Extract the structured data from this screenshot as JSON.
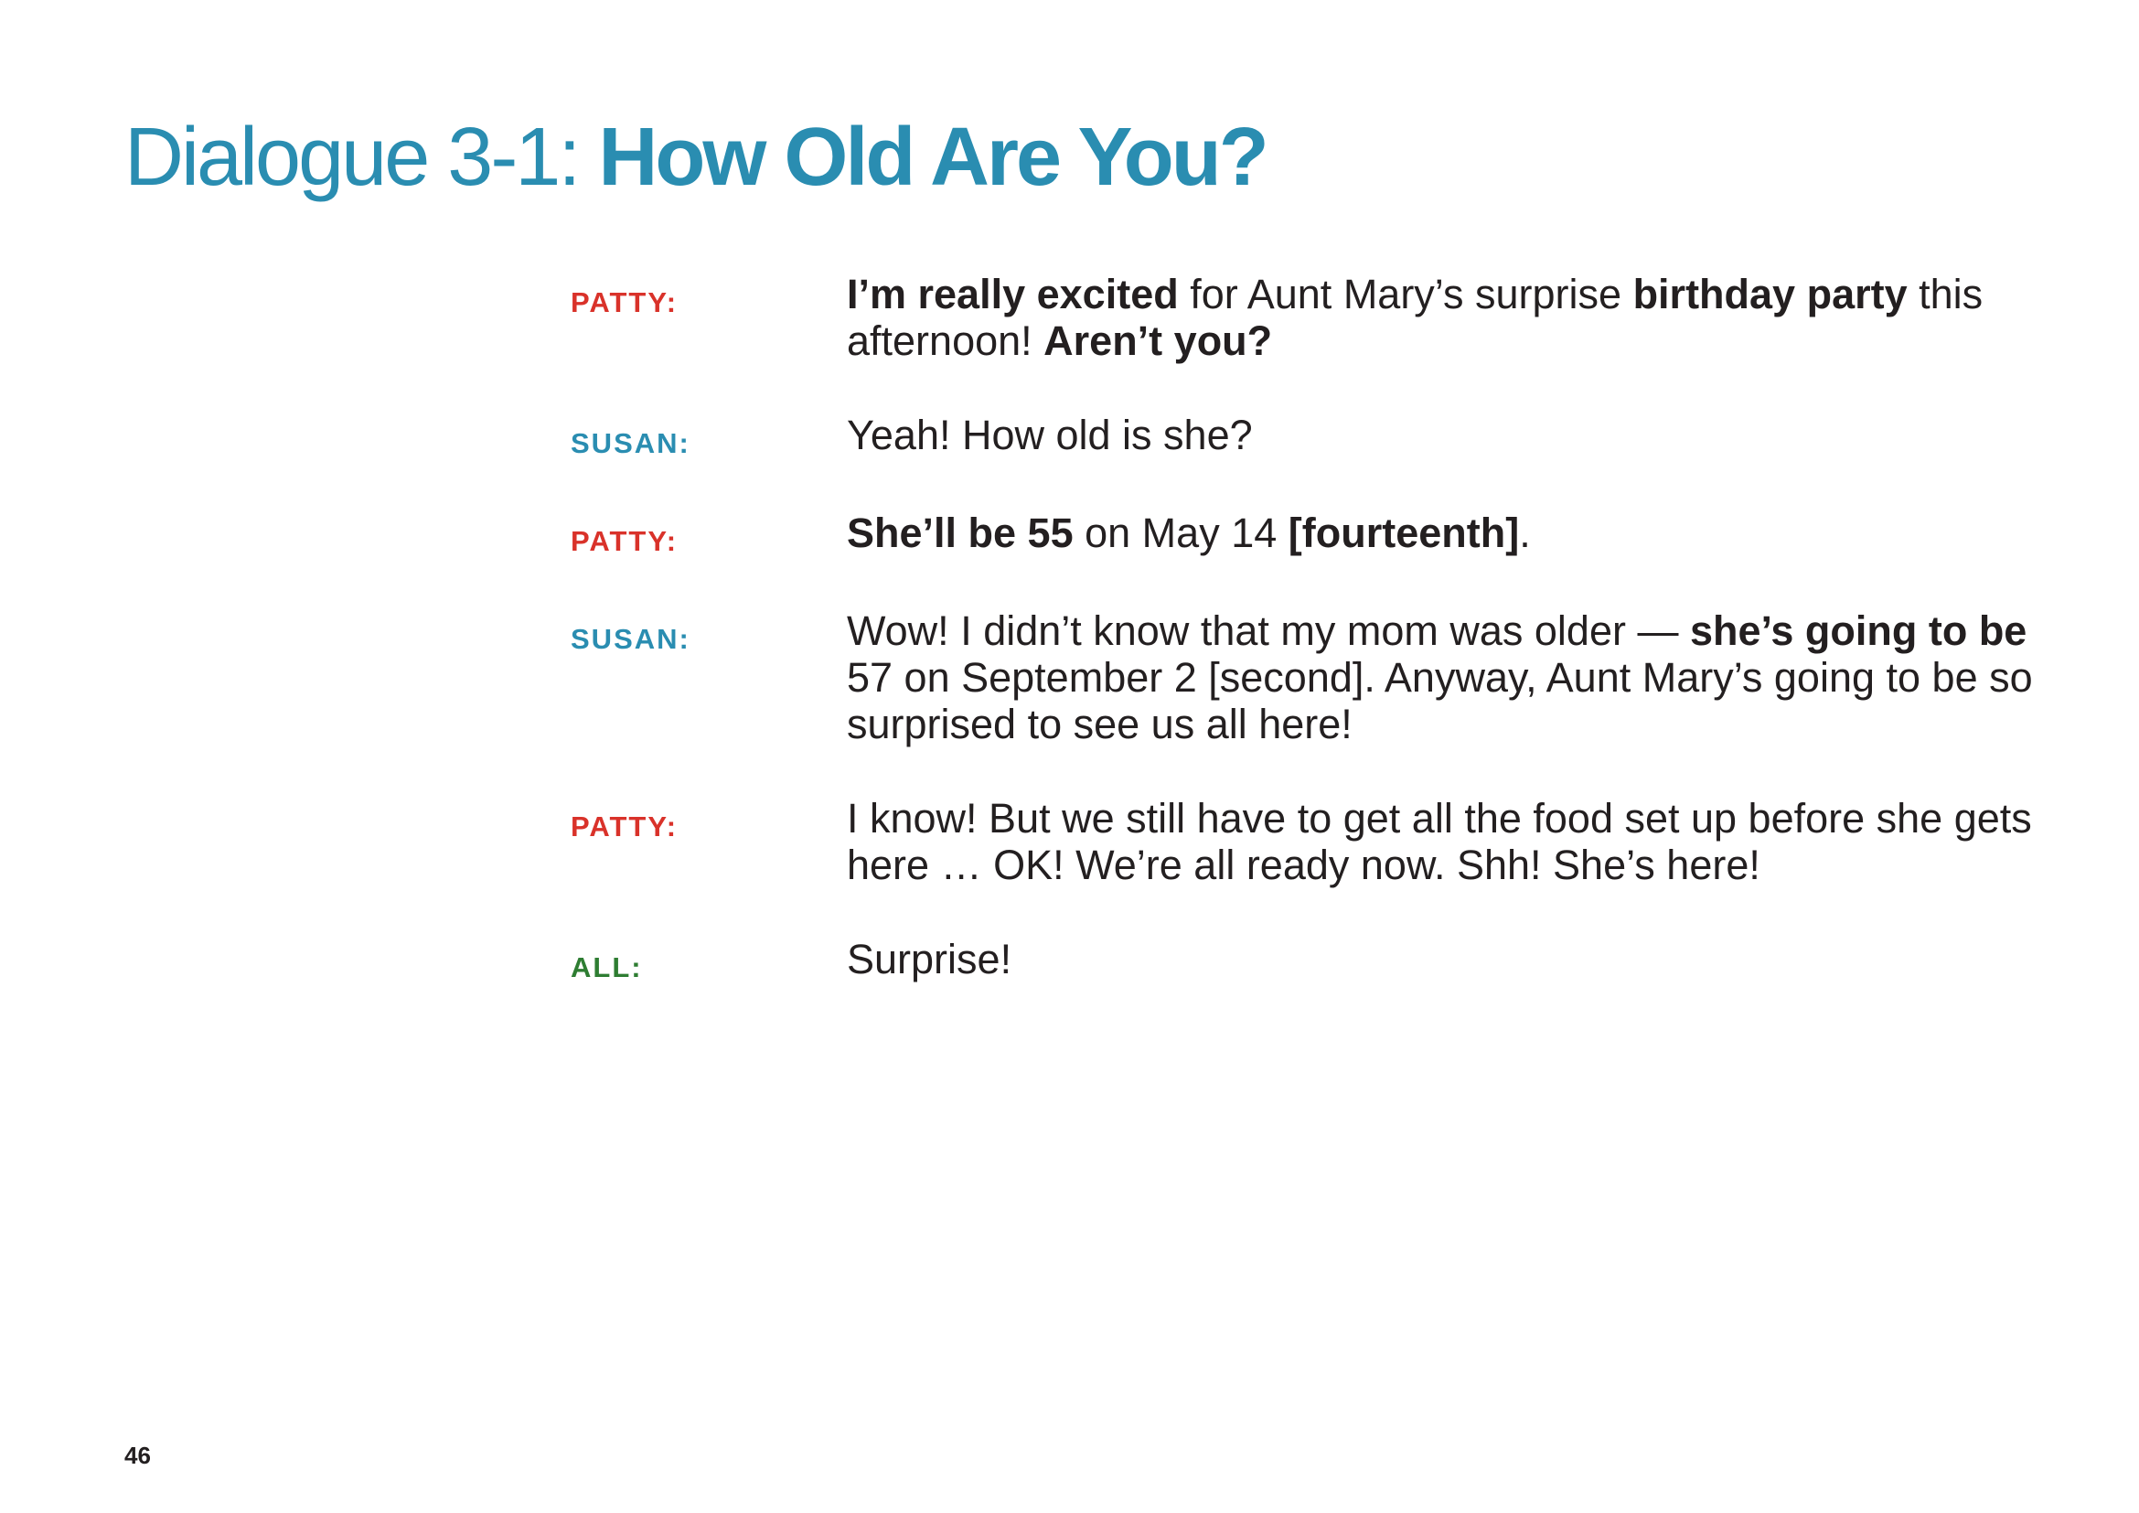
{
  "title": {
    "prefix": "Dialogue 3-1: ",
    "main": "How Old Are You?"
  },
  "colors": {
    "title": "#2a8db1",
    "patty": "#d9322a",
    "susan": "#2a8db1",
    "all": "#2e7d32",
    "body_text": "#231f20"
  },
  "dialogue": [
    {
      "speaker": "PATTY:",
      "segments": [
        {
          "t": "I’m really excited",
          "b": true
        },
        {
          "t": " for Aunt Mary’s surprise ",
          "b": false
        },
        {
          "t": "birthday party",
          "b": true
        },
        {
          "t": " this afternoon! ",
          "b": false
        },
        {
          "t": "Aren’t you?",
          "b": true
        }
      ]
    },
    {
      "speaker": "SUSAN:",
      "segments": [
        {
          "t": "Yeah! How old is she?",
          "b": false
        }
      ]
    },
    {
      "speaker": "PATTY:",
      "segments": [
        {
          "t": "She’ll be 55",
          "b": true
        },
        {
          "t": " on May 14 ",
          "b": false
        },
        {
          "t": "[fourteenth]",
          "b": true
        },
        {
          "t": ".",
          "b": false
        }
      ]
    },
    {
      "speaker": "SUSAN:",
      "segments": [
        {
          "t": "Wow! I didn’t know that my mom was older — ",
          "b": false
        },
        {
          "t": "she’s going to be",
          "b": true
        },
        {
          "t": " 57 on September 2 [second]. Anyway, Aunt Mary’s going to be so surprised to see us all here!",
          "b": false
        }
      ]
    },
    {
      "speaker": "PATTY:",
      "segments": [
        {
          "t": "I know! But we still have to get all the food set up before she gets here …  OK! We’re all ready now. Shh! She’s here!",
          "b": false
        }
      ]
    },
    {
      "speaker": "ALL:",
      "segments": [
        {
          "t": "Surprise!",
          "b": false
        }
      ]
    }
  ],
  "page_number": "46"
}
